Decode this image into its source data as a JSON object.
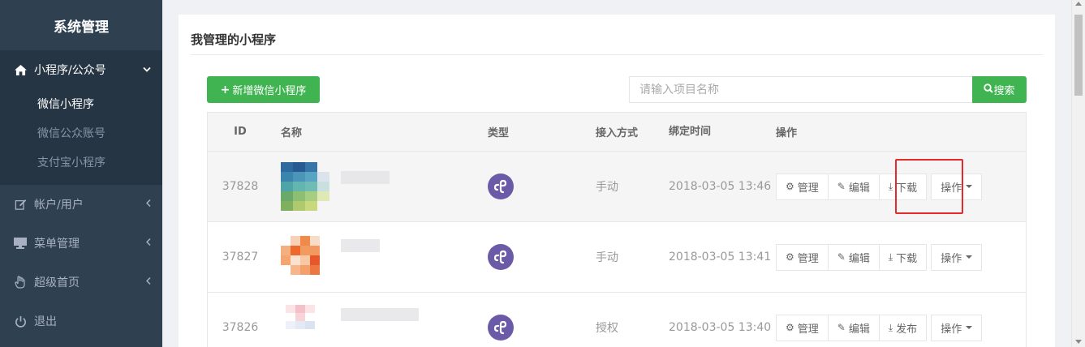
{
  "sidebar": {
    "brand": "系统管理",
    "menu": [
      {
        "label": "小程序/公众号",
        "icon": "home-icon",
        "arrow": "chevron-down-icon"
      },
      {
        "label": "帐户/用户",
        "icon": "edit-icon",
        "arrow": "chevron-left-icon"
      },
      {
        "label": "菜单管理",
        "icon": "desktop-icon",
        "arrow": "chevron-left-icon"
      },
      {
        "label": "超级首页",
        "icon": "hand-icon",
        "arrow": "chevron-left-icon"
      },
      {
        "label": "退出",
        "icon": "power-icon"
      }
    ],
    "submenu": [
      "微信小程序",
      "微信公众账号",
      "支付宝小程序"
    ]
  },
  "panel": {
    "title": "我管理的小程序",
    "add_button": "新增微信小程序",
    "search_placeholder": "请输入项目名称",
    "search_button": "搜索"
  },
  "table": {
    "headers": [
      "ID",
      "名称",
      "类型",
      "接入方式",
      "绑定时间",
      "操作"
    ],
    "rows": [
      {
        "id": "37828",
        "mode": "手动",
        "time": "2018-03-05 13:46",
        "ops": [
          "管理",
          "编辑",
          "下载"
        ],
        "more": "操作"
      },
      {
        "id": "37827",
        "mode": "手动",
        "time": "2018-03-05 13:41",
        "ops": [
          "管理",
          "编辑",
          "下载"
        ],
        "more": "操作"
      },
      {
        "id": "37826",
        "mode": "授权",
        "time": "2018-03-05 13:40",
        "ops": [
          "管理",
          "编辑",
          "发布"
        ],
        "more": "操作"
      }
    ]
  },
  "colors": {
    "sidebar_bg": "#2f4050",
    "accent_green": "#3fb451",
    "miniprogram_purple": "#6a5aa7",
    "highlight_red": "#e52a2a"
  }
}
